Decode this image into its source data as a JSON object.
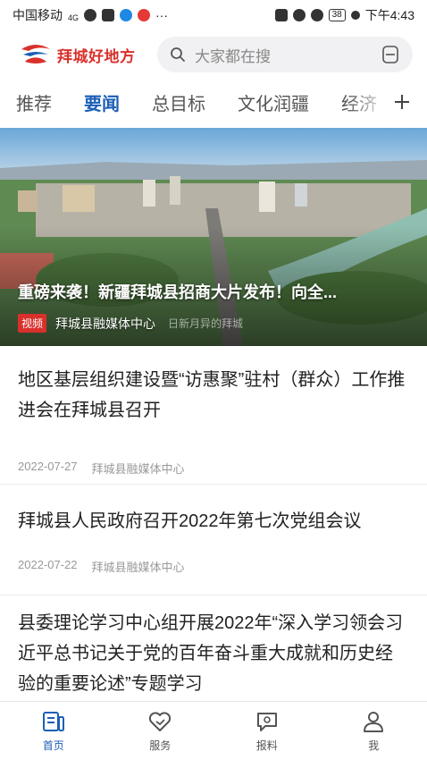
{
  "status_bar": {
    "carrier": "中国移动",
    "network": "4G",
    "battery": "38",
    "time": "下午4:43"
  },
  "header": {
    "logo_text": "拜城好地方",
    "search_placeholder": "大家都在搜"
  },
  "tabs": [
    {
      "label": "推荐",
      "active": false
    },
    {
      "label": "要闻",
      "active": true
    },
    {
      "label": "总目标",
      "active": false
    },
    {
      "label": "文化润疆",
      "active": false
    },
    {
      "label": "经济",
      "active": false
    }
  ],
  "hero": {
    "title": "重磅来袭！新疆拜城县招商大片发布！向全...",
    "badge": "视频",
    "source": "拜城县融媒体中心",
    "watermark": "日新月异的拜城"
  },
  "news": [
    {
      "title": "地区基层组织建设暨“访惠聚”驻村（群众）工作推进会在拜城县召开",
      "date": "2022-07-27",
      "source": "拜城县融媒体中心"
    },
    {
      "title": "拜城县人民政府召开2022年第七次党组会议",
      "date": "2022-07-22",
      "source": "拜城县融媒体中心"
    },
    {
      "title": "县委理论学习中心组开展2022年“深入学习领会习近平总书记关于党的百年奋斗重大成就和历史经验的重要论述”专题学习",
      "date": "",
      "source": ""
    }
  ],
  "bottom_nav": [
    {
      "label": "首页",
      "icon": "home-news-icon",
      "active": true
    },
    {
      "label": "服务",
      "icon": "heart-service-icon",
      "active": false
    },
    {
      "label": "报料",
      "icon": "report-message-icon",
      "active": false
    },
    {
      "label": "我",
      "icon": "profile-icon",
      "active": false
    }
  ],
  "colors": {
    "brand_red": "#d9302b",
    "accent_blue": "#1b5fb6"
  }
}
